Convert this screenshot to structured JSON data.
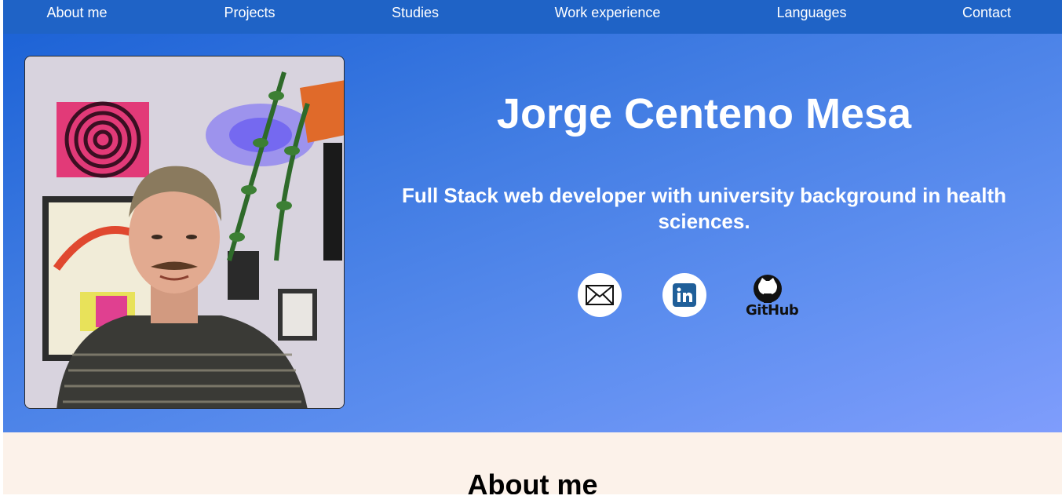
{
  "nav": {
    "items": [
      {
        "label": "About me"
      },
      {
        "label": "Projects"
      },
      {
        "label": "Studies"
      },
      {
        "label": "Work experience"
      },
      {
        "label": "Languages"
      },
      {
        "label": "Contact"
      }
    ]
  },
  "hero": {
    "name": "Jorge Centeno Mesa",
    "tagline": "Full Stack web developer with university background in health sciences.",
    "photo_icon": "profile-photo",
    "social": [
      {
        "icon": "envelope-icon"
      },
      {
        "icon": "linkedin-icon"
      },
      {
        "icon": "github-icon",
        "label": "GitHub"
      }
    ]
  },
  "about": {
    "title": "About me"
  },
  "colors": {
    "navbar": "#1f63c6",
    "hero_gradient_start": "#1d63d6",
    "hero_gradient_end": "#7f9dfc",
    "about_background": "#fcf2ea",
    "linkedin_blue": "#1f5f99"
  }
}
